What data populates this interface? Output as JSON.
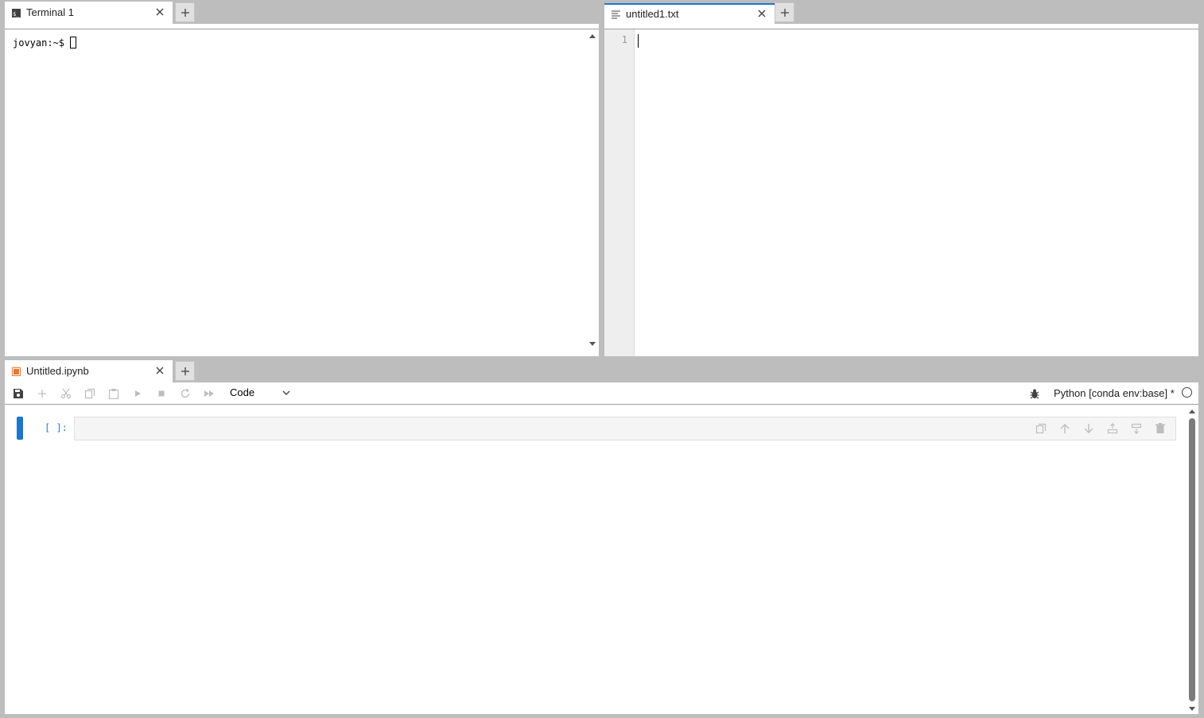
{
  "terminal": {
    "tab_label": "Terminal 1",
    "prompt": "jovyan:~$ ",
    "icon": "terminal-icon"
  },
  "editor": {
    "tab_label": "untitled1.txt",
    "line_numbers": [
      "1"
    ],
    "icon": "text-file-icon"
  },
  "notebook": {
    "tab_label": "Untitled.ipynb",
    "icon": "notebook-icon",
    "toolbar": {
      "cell_type": "Code",
      "kernel_name": "Python [conda env:base] *",
      "buttons": [
        "save-icon",
        "add-icon",
        "cut-icon",
        "copy-icon",
        "paste-icon",
        "run-icon",
        "stop-icon",
        "restart-icon",
        "fast-forward-icon"
      ]
    },
    "cells": [
      {
        "prompt": "[ ]:",
        "source": ""
      }
    ],
    "cell_toolbar": [
      "duplicate-icon",
      "move-up-icon",
      "move-down-icon",
      "insert-above-icon",
      "insert-below-icon",
      "delete-icon"
    ]
  },
  "colors": {
    "accent": "#1976d2",
    "background": "#bdbdbd",
    "panel": "#ffffff",
    "notebook_icon": "#f37726",
    "prompt": "#307fc1"
  }
}
